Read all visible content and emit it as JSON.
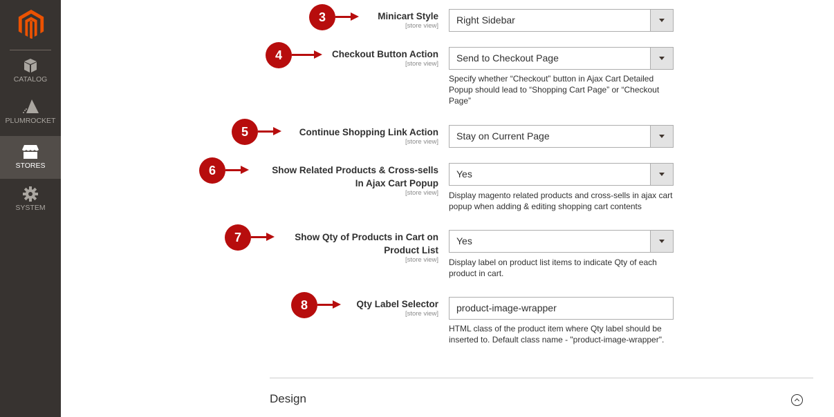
{
  "sidebar": {
    "logo": "magento-logo",
    "items": [
      {
        "label": "CATALOG",
        "icon": "box-icon",
        "active": false
      },
      {
        "label": "PLUMROCKET",
        "icon": "plumrocket-pyramid-icon",
        "active": false
      },
      {
        "label": "STORES",
        "icon": "storefront-icon",
        "active": true
      },
      {
        "label": "SYSTEM",
        "icon": "gear-icon",
        "active": false
      }
    ]
  },
  "fields": [
    {
      "marker": "3",
      "label_lines": [
        "Minicart Style"
      ],
      "scope": "[store view]",
      "type": "select",
      "value": "Right Sidebar",
      "note": ""
    },
    {
      "marker": "4",
      "label_lines": [
        "Checkout Button Action"
      ],
      "scope": "[store view]",
      "type": "select",
      "value": "Send to Checkout Page",
      "note": "Specify whether “Checkout” button in Ajax Cart Detailed Popup should lead to “Shopping Cart Page” or “Checkout Page”"
    },
    {
      "marker": "5",
      "label_lines": [
        "Continue Shopping Link Action"
      ],
      "scope": "[store view]",
      "type": "select",
      "value": "Stay on Current Page",
      "note": ""
    },
    {
      "marker": "6",
      "label_lines": [
        "Show Related Products & Cross-sells",
        "In Ajax Cart Popup"
      ],
      "scope": "[store view]",
      "type": "select",
      "value": "Yes",
      "note": "Display magento related products and cross-sells in ajax cart popup when adding & editing shopping cart contents"
    },
    {
      "marker": "7",
      "label_lines": [
        "Show Qty of Products in Cart on",
        "Product List"
      ],
      "scope": "[store view]",
      "type": "select",
      "value": "Yes",
      "note": "Display label on product list items to indicate Qty of each product in cart."
    },
    {
      "marker": "8",
      "label_lines": [
        "Qty Label Selector"
      ],
      "scope": "[store view]",
      "type": "input",
      "value": "product-image-wrapper",
      "note": "HTML class of the product item where Qty label should be inserted to. Default class name - \"product-image-wrapper\"."
    }
  ],
  "section": {
    "title": "Design",
    "collapse_icon": "chevron-up-circle-icon"
  },
  "colors": {
    "marker": "#b70d0d",
    "sidebar_bg": "#373330",
    "sidebar_active": "#524d49",
    "logo": "#eb5202"
  }
}
